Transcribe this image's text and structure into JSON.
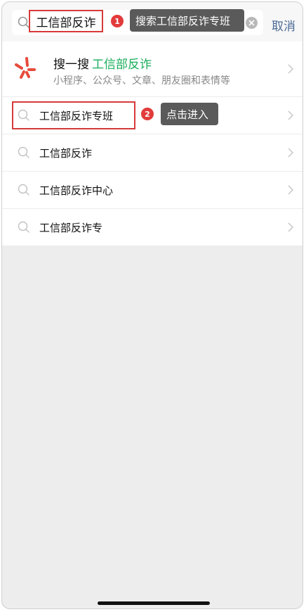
{
  "search": {
    "query": "工信部反诈",
    "cancel_label": "取消"
  },
  "annotations": [
    {
      "number": "1",
      "text": "搜索工信部反诈专班"
    },
    {
      "number": "2",
      "text": "点击进入"
    }
  ],
  "results": {
    "sou_yi_sou": {
      "label": "搜一搜",
      "keyword": "工信部反诈",
      "subtitle": "小程序、公众号、文章、朋友圈和表情等"
    },
    "suggestions": [
      {
        "label": "工信部反诈专班"
      },
      {
        "label": "工信部反诈"
      },
      {
        "label": "工信部反诈中心"
      },
      {
        "label": "工信部反诈专"
      }
    ]
  },
  "colors": {
    "accent_green": "#1aad5a",
    "annotation_red": "#e23b3b",
    "cancel_blue": "#4b6a97",
    "background": "#ededed"
  }
}
